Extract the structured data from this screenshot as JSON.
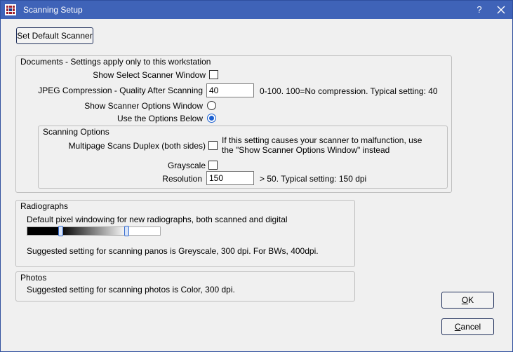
{
  "window": {
    "title": "Scanning Setup",
    "help_label": "?"
  },
  "toolbar": {
    "set_default_scanner": "Set Default Scanner"
  },
  "documents": {
    "group_label": "Documents - Settings apply only to this workstation",
    "show_select_scanner_window": {
      "label": "Show Select Scanner Window",
      "checked": false
    },
    "jpeg": {
      "label": "JPEG Compression - Quality After Scanning",
      "value": "40",
      "hint": "0-100. 100=No compression.  Typical setting: 40"
    },
    "show_scanner_options_window": {
      "label": "Show Scanner Options Window",
      "selected": false
    },
    "use_options_below": {
      "label": "Use the Options Below",
      "selected": true
    },
    "scanning_options": {
      "group_label": "Scanning Options",
      "duplex": {
        "label": "Multipage Scans Duplex (both sides)",
        "checked": false,
        "hint_line1": "If this setting causes your scanner to malfunction, use",
        "hint_line2": "the \"Show Scanner Options Window\" instead"
      },
      "grayscale": {
        "label": "Grayscale",
        "checked": false
      },
      "resolution": {
        "label": "Resolution",
        "value": "150",
        "hint": "> 50. Typical setting: 150 dpi"
      }
    }
  },
  "radiographs": {
    "group_label": "Radiographs",
    "windowing_label": "Default pixel windowing for new radiographs, both scanned and digital",
    "window_min": 0.25,
    "window_max": 0.75,
    "suggestion": "Suggested setting for scanning panos is Greyscale, 300 dpi.  For BWs, 400dpi."
  },
  "photos": {
    "group_label": "Photos",
    "suggestion": "Suggested setting for scanning photos is Color, 300 dpi."
  },
  "buttons": {
    "ok_mnemonic": "O",
    "ok_rest": "K",
    "cancel_mnemonic": "C",
    "cancel_rest": "ancel"
  }
}
